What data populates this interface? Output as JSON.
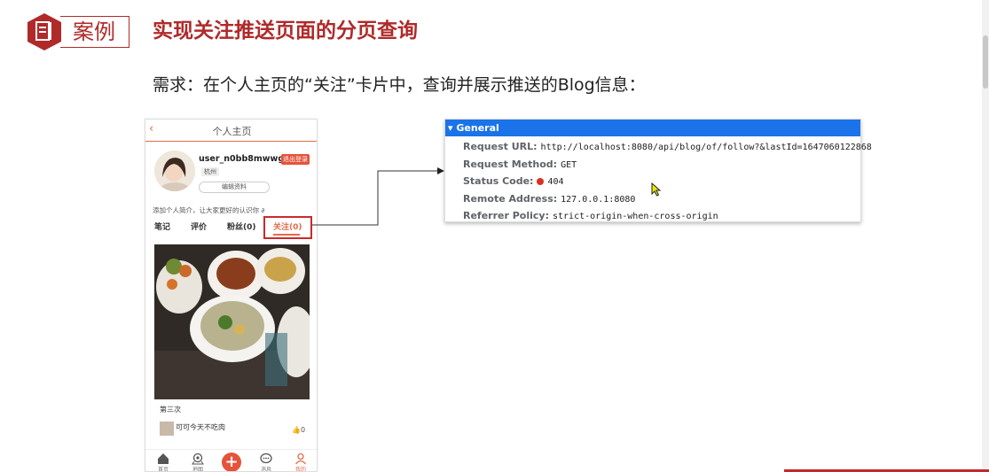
{
  "slide": {
    "badge_label": "案例",
    "title": "实现关注推送页面的分页查询",
    "requirement": "需求：在个人主页的“关注”卡片中，查询并展示推送的Blog信息："
  },
  "phone": {
    "back_icon": "‹",
    "header_title": "个人主页",
    "username": "user_n0bb8mwwg4",
    "logout_label": "退出登录",
    "city": "杭州",
    "edit_label": "编辑资料",
    "intro": "添加个人简介，让大家更好的认识你 ∂",
    "tabs": [
      {
        "label": "笔记"
      },
      {
        "label": "评价"
      },
      {
        "label": "粉丝(0)"
      },
      {
        "label": "关注(0)"
      }
    ],
    "card": {
      "title": "第三次",
      "author": "可可今天不吃肉",
      "likes": "0"
    },
    "nav": [
      {
        "label": "首页",
        "icon": "home-icon"
      },
      {
        "label": "地图",
        "icon": "map-pin-icon"
      },
      {
        "label": "+",
        "icon": "plus-icon"
      },
      {
        "label": "消息",
        "icon": "chat-icon"
      },
      {
        "label": "我的",
        "icon": "user-icon"
      }
    ],
    "accent": "#e26b4a"
  },
  "devtools": {
    "section": "General",
    "rows": [
      {
        "key": "Request URL:",
        "value": "http://localhost:8080/api/blog/of/follow?&lastId=1647060122868"
      },
      {
        "key": "Request Method:",
        "value": "GET"
      },
      {
        "key": "Status Code:",
        "value": "404"
      },
      {
        "key": "Remote Address:",
        "value": "127.0.0.1:8080"
      },
      {
        "key": "Referrer Policy:",
        "value": "strict-origin-when-cross-origin"
      }
    ],
    "header_color": "#1a73e8",
    "status_color": "#d93025"
  }
}
